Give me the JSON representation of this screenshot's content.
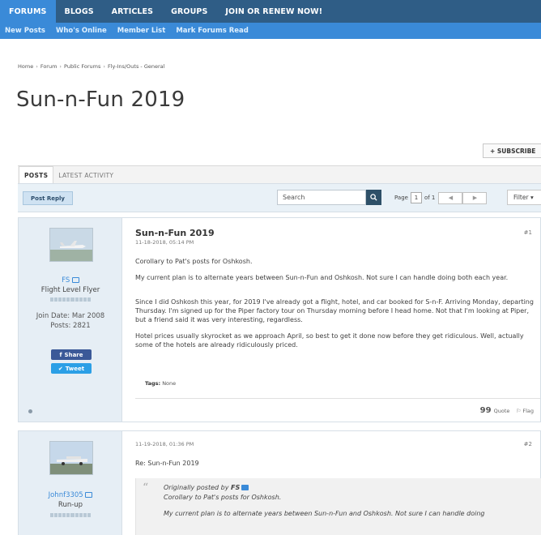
{
  "topnav": {
    "tabs": [
      "FORUMS",
      "BLOGS",
      "ARTICLES",
      "GROUPS",
      "JOIN OR RENEW NOW!"
    ]
  },
  "subnav": {
    "links": [
      "New Posts",
      "Who's Online",
      "Member List",
      "Mark Forums Read"
    ]
  },
  "breadcrumb": [
    "Home",
    "Forum",
    "Public Forums",
    "Fly-Ins/Outs - General"
  ],
  "page": {
    "title": "Sun-n-Fun 2019"
  },
  "subscribe": {
    "label": "+ SUBSCRIBE"
  },
  "tabs": [
    "POSTS",
    "LATEST ACTIVITY"
  ],
  "toolbar": {
    "post_reply": "Post Reply",
    "search_value": "Search",
    "page_label": "Page",
    "page_current": "1",
    "page_of": "of 1",
    "filter": "Filter ▾"
  },
  "posts": [
    {
      "username": "FS",
      "rank": "Flight Level Flyer",
      "join_date": "Join Date: Mar 2008",
      "post_count": "Posts: 2821",
      "share_label": "Share",
      "tweet_label": "Tweet",
      "title": "Sun-n-Fun 2019",
      "date": "11-18-2018, 05:14 PM",
      "number": "#1",
      "paragraphs": [
        "Corollary to Pat's posts for Oshkosh.",
        "My current plan is to alternate years between Sun-n-Fun and Oshkosh. Not sure I can handle doing both each year.",
        "Since I did Oshkosh this year, for 2019 I've already got a flight, hotel, and car booked for S-n-F. Arriving Monday, departing Thursday. I'm signed up for the Piper factory tour on Thursday morning before I head home. Not that I'm looking at Piper, but a friend said it was very interesting, regardless.",
        "Hotel prices usually skyrocket as we approach April, so best to get it done now before they get ridiculous. Well, actually some of the hotels are already ridiculously priced."
      ],
      "tags_label": "Tags:",
      "tags_value": "None",
      "quote_label": "Quote",
      "flag_label": "Flag"
    },
    {
      "username": "Johnf3305",
      "rank": "Run-up",
      "date": "11-19-2018, 01:36 PM",
      "number": "#2",
      "reply_title": "Re: Sun-n-Fun 2019",
      "quote_prefix": "Originally posted by",
      "quote_author": "FS",
      "quote_line1": "Corollary to Pat's posts for Oshkosh.",
      "quote_line2": "My current plan is to alternate years between Sun-n-Fun and Oshkosh. Not sure I can handle doing"
    }
  ],
  "colors": {
    "nav_bg": "#2f5d86",
    "nav_active": "#3a8ad8",
    "link": "#3a8ad8",
    "sidebar_bg": "#e6eef5",
    "facebook": "#3b5998",
    "twitter": "#2b9fe6"
  }
}
